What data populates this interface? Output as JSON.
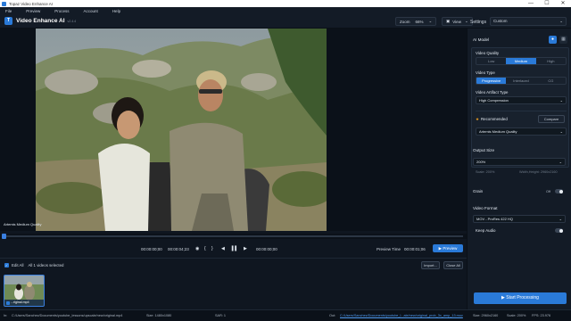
{
  "window": {
    "title": "Topaz Video Enhance AI",
    "minimize": "—",
    "maximize": "☐",
    "close": "✕"
  },
  "menu": [
    "File",
    "Preview",
    "Process",
    "Account",
    "Help"
  ],
  "toolbar": {
    "logo": "T",
    "app_name": "Video Enhance AI",
    "version": "v2.4.4",
    "zoom_label": "Zoom",
    "zoom_value": "66%",
    "view_label": "View",
    "settings_label": "Settings",
    "settings_value": "Custom"
  },
  "preview": {
    "model_overlay": "Artemis Medium Quality",
    "scrub_progress": 0.0
  },
  "transport": {
    "start_time": "00:00:00;00",
    "current_time": "00:00:04;23",
    "end_time": "00:00:00;00",
    "preview_time_label": "Preview Time",
    "preview_time_value": "00:00:01;06",
    "preview_button": "Preview"
  },
  "list": {
    "edit_all": "Edit All",
    "selected_count": "All 1 videos selected",
    "import_button": "Import...",
    "close_all_button": "Close All",
    "items": [
      {
        "name": "...riginal.mp4"
      }
    ]
  },
  "status": {
    "in_label": "In:",
    "in_path": "C:/Users/Sanchez/Documents/youtube_lessons/upscale/new/original.mp4",
    "in_size": "Size: 1480x1080",
    "sar": "SAR: 1",
    "out_label": "Out:",
    "out_path": "C:/Users/Sanchez/Documents/youtube_l...ale/new/original_prob_3x_amp_13.mov",
    "out_size": "Size: 2960x2160",
    "scale": "Scale: 200%",
    "fps": "FPS: 23.976"
  },
  "panel": {
    "ai_model_title": "AI Model",
    "video_quality_label": "Video Quality",
    "quality_options": [
      "Low",
      "Medium",
      "High"
    ],
    "quality_selected": 1,
    "video_type_label": "Video Type",
    "type_options": [
      "Progressive",
      "Interlaced",
      "CG"
    ],
    "type_selected": 0,
    "artifact_label": "Video Artifact Type",
    "artifact_value": "High Compression",
    "recommended_label": "Recommended",
    "compare_button": "Compare",
    "model_value": "Artemis Medium Quality",
    "output_size_title": "Output Size",
    "output_size_value": "200%",
    "scale_text": "Scale: 200%",
    "wh_text": "Width,Height: 2960x2160",
    "grain_label": "Grain",
    "grain_state": "Off",
    "video_format_title": "Video Format",
    "format_value": "MOV - ProRes 422 HQ",
    "keep_audio_label": "Keep Audio",
    "start_button": "Start Processing"
  },
  "colors": {
    "accent": "#2a7ad8",
    "background": "#0f1620",
    "panel": "#131b26"
  }
}
